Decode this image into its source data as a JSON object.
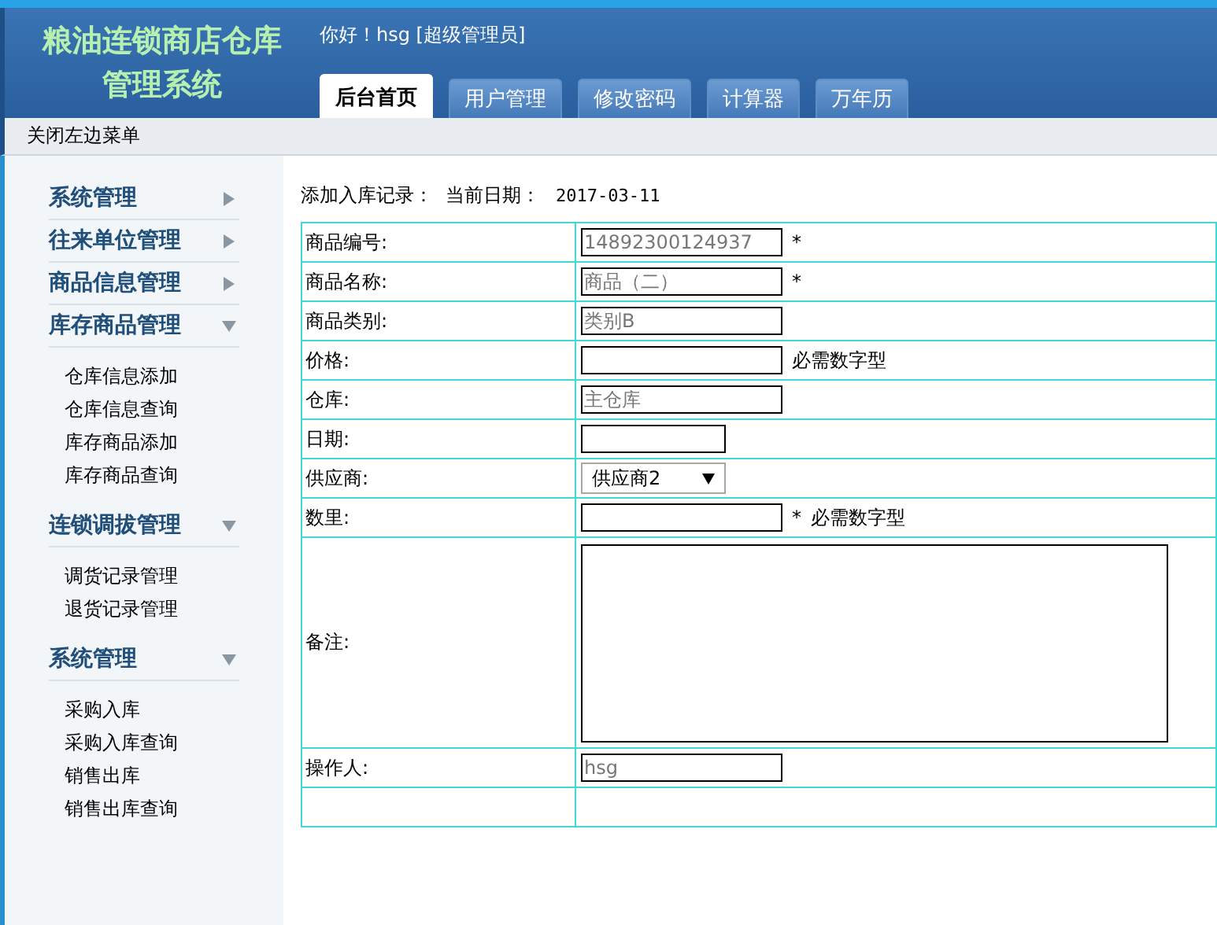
{
  "header": {
    "title_lines": [
      "粮油连锁商店仓库",
      "管理系统"
    ],
    "greeting": "你好！hsg [超级管理员]",
    "tabs": [
      {
        "label": "后台首页",
        "selected": true
      },
      {
        "label": "用户管理",
        "selected": false
      },
      {
        "label": "修改密码",
        "selected": false
      },
      {
        "label": "计算器",
        "selected": false
      },
      {
        "label": "万年历",
        "selected": false
      }
    ]
  },
  "toolbar": {
    "toggle_menu": "关闭左边菜单"
  },
  "sidebar": {
    "groups": [
      {
        "title": "系统管理",
        "expanded": false
      },
      {
        "title": "往来单位管理",
        "expanded": false
      },
      {
        "title": "商品信息管理",
        "expanded": false
      },
      {
        "title": "库存商品管理",
        "expanded": true,
        "items": [
          "仓库信息添加",
          "仓库信息查询",
          "库存商品添加",
          "库存商品查询"
        ]
      },
      {
        "title": "连锁调拔管理",
        "expanded": true,
        "items": [
          "调货记录管理",
          "退货记录管理"
        ]
      },
      {
        "title": "系统管理",
        "expanded": true,
        "items": [
          "采购入库",
          "采购入库查询",
          "销售出库",
          "销售出库查询"
        ]
      }
    ]
  },
  "form": {
    "heading": "添加入库记录：",
    "date_label": "当前日期：",
    "date": "2017-03-11",
    "rows": [
      {
        "label": "商品编号:",
        "kind": "text",
        "value": "14892300124937",
        "readonly": true,
        "required": "*"
      },
      {
        "label": "商品名称:",
        "kind": "text",
        "value": "商品（二）",
        "readonly": true,
        "required": "*"
      },
      {
        "label": "商品类别:",
        "kind": "text",
        "value": "类别B",
        "readonly": true
      },
      {
        "label": "价格:",
        "kind": "text",
        "note": "必需数字型"
      },
      {
        "label": "仓库:",
        "kind": "text",
        "value": "主仓库",
        "readonly": true
      },
      {
        "label": "日期:",
        "kind": "date"
      },
      {
        "label": "供应商:",
        "kind": "select",
        "value": "供应商2"
      },
      {
        "label": "数里:",
        "kind": "text",
        "required": "*",
        "note": "必需数字型"
      },
      {
        "label": "备注:",
        "kind": "textarea"
      },
      {
        "label": "操作人:",
        "kind": "text",
        "value": "hsg",
        "readonly": true
      },
      {
        "kind": "blank"
      }
    ]
  }
}
